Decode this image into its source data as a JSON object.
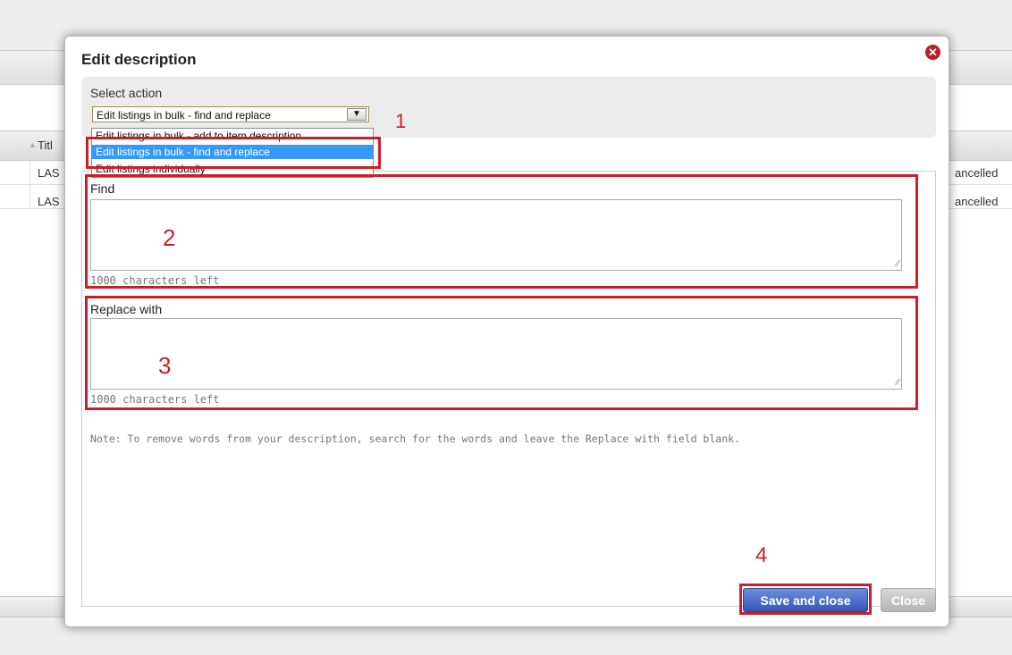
{
  "background": {
    "table_header_col": "Titl",
    "rows": [
      {
        "title": "LAS",
        "status": "ancelled"
      },
      {
        "title": "LAS",
        "status": "ancelled"
      }
    ]
  },
  "dialog": {
    "title": "Edit description",
    "close_icon": "close-icon",
    "select_action_label": "Select action",
    "selected_value": "Edit listings in bulk - find and replace",
    "dropdown_options": [
      "Edit listings in bulk - add to item description",
      "Edit listings in bulk - find and replace",
      "Edit listings individually"
    ],
    "find": {
      "label": "Find",
      "value": "",
      "chars_left": "1000 characters left"
    },
    "replace": {
      "label": "Replace with",
      "value": "",
      "chars_left": "1000 characters left"
    },
    "note": "Note: To remove words from your description, search for the words and leave the Replace with field blank.",
    "save_label": "Save and close",
    "close_label": "Close"
  },
  "annotations": {
    "steps": [
      "1",
      "2",
      "3",
      "4"
    ],
    "color": "#c8202a"
  },
  "colors": {
    "primary_button": "#3556b8",
    "selected_option": "#3399ff"
  }
}
